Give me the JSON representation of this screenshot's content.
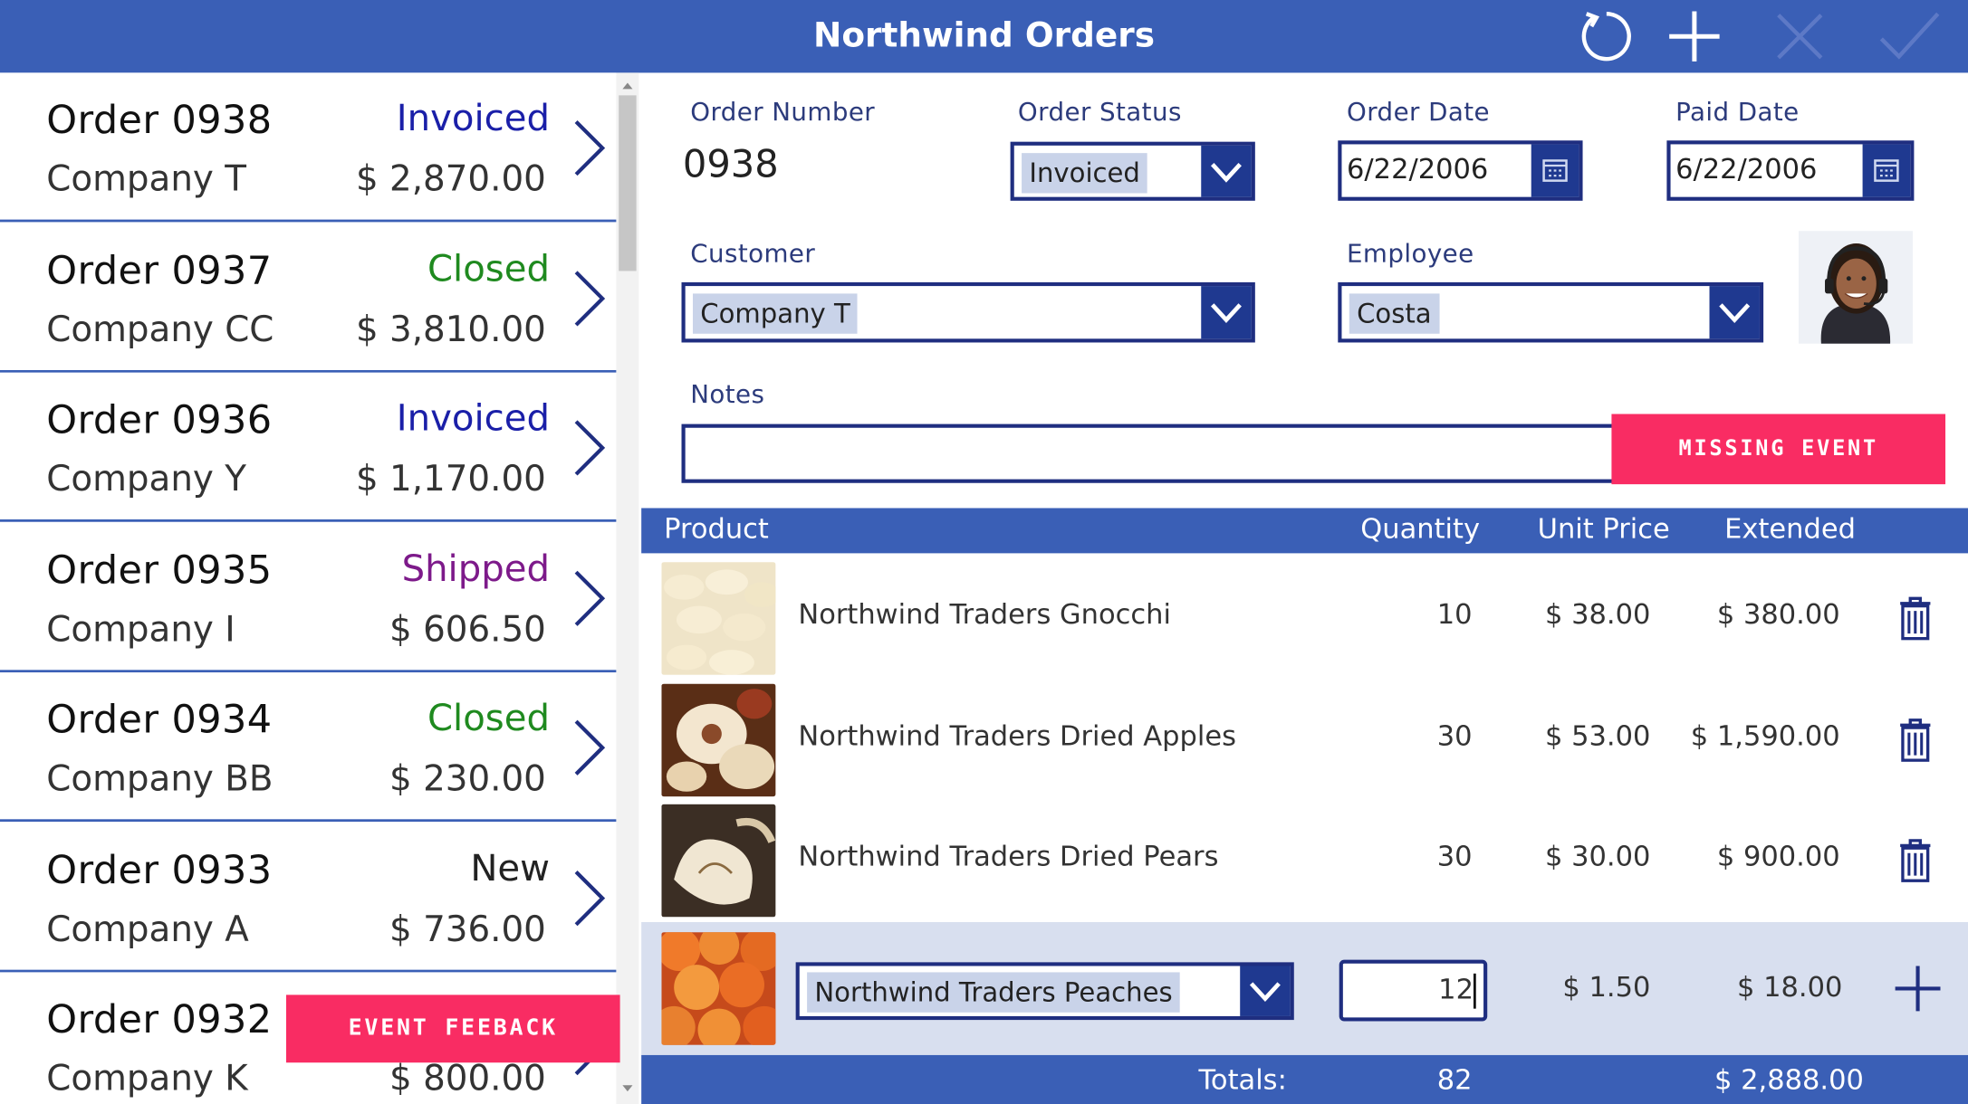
{
  "header": {
    "title": "Northwind Orders",
    "icons": [
      "refresh-icon",
      "add-icon",
      "cancel-icon",
      "check-icon"
    ],
    "bar_color": "#3a5fb6"
  },
  "orders": [
    {
      "title": "Order 0938",
      "status": "Invoiced",
      "status_color": "#1a1fa8",
      "company": "Company T",
      "total": "$ 2,870.00"
    },
    {
      "title": "Order 0937",
      "status": "Closed",
      "status_color": "#1f8a1f",
      "company": "Company CC",
      "total": "$ 3,810.00"
    },
    {
      "title": "Order 0936",
      "status": "Invoiced",
      "status_color": "#1a1fa8",
      "company": "Company Y",
      "total": "$ 1,170.00"
    },
    {
      "title": "Order 0935",
      "status": "Shipped",
      "status_color": "#7d1a8a",
      "company": "Company I",
      "total": "$ 606.50"
    },
    {
      "title": "Order 0934",
      "status": "Closed",
      "status_color": "#1f8a1f",
      "company": "Company BB",
      "total": "$ 230.00"
    },
    {
      "title": "Order 0933",
      "status": "New",
      "status_color": "#222222",
      "company": "Company A",
      "total": "$ 736.00"
    },
    {
      "title": "Order 0932",
      "status": "",
      "status_color": "#222222",
      "company": "Company K",
      "total": "$ 800.00"
    }
  ],
  "overlays": {
    "event_feedback": "EVENT FEEBACK",
    "missing_event": "MISSING EVENT"
  },
  "form": {
    "order_number": {
      "label": "Order Number",
      "value": "0938"
    },
    "order_status": {
      "label": "Order Status",
      "value": "Invoiced"
    },
    "order_date": {
      "label": "Order Date",
      "value": "6/22/2006"
    },
    "paid_date": {
      "label": "Paid Date",
      "value": "6/22/2006"
    },
    "customer": {
      "label": "Customer",
      "value": "Company T"
    },
    "employee": {
      "label": "Employee",
      "value": "Costa"
    },
    "notes": {
      "label": "Notes",
      "value": ""
    }
  },
  "table": {
    "headers": {
      "product": "Product",
      "quantity": "Quantity",
      "unit_price": "Unit Price",
      "extended": "Extended"
    },
    "rows": [
      {
        "product": "Northwind Traders Gnocchi",
        "quantity": "10",
        "unit_price": "$ 38.00",
        "extended": "$ 380.00",
        "image": "gnocchi"
      },
      {
        "product": "Northwind Traders Dried Apples",
        "quantity": "30",
        "unit_price": "$ 53.00",
        "extended": "$ 1,590.00",
        "image": "dried-apples"
      },
      {
        "product": "Northwind Traders Dried Pears",
        "quantity": "30",
        "unit_price": "$ 30.00",
        "extended": "$ 900.00",
        "image": "dried-pears"
      }
    ],
    "new_row": {
      "product": "Northwind Traders Peaches",
      "quantity": "12",
      "unit_price": "$ 1.50",
      "extended": "$ 18.00",
      "image": "peaches"
    },
    "totals": {
      "label": "Totals:",
      "quantity": "82",
      "extended": "$ 2,888.00"
    }
  }
}
